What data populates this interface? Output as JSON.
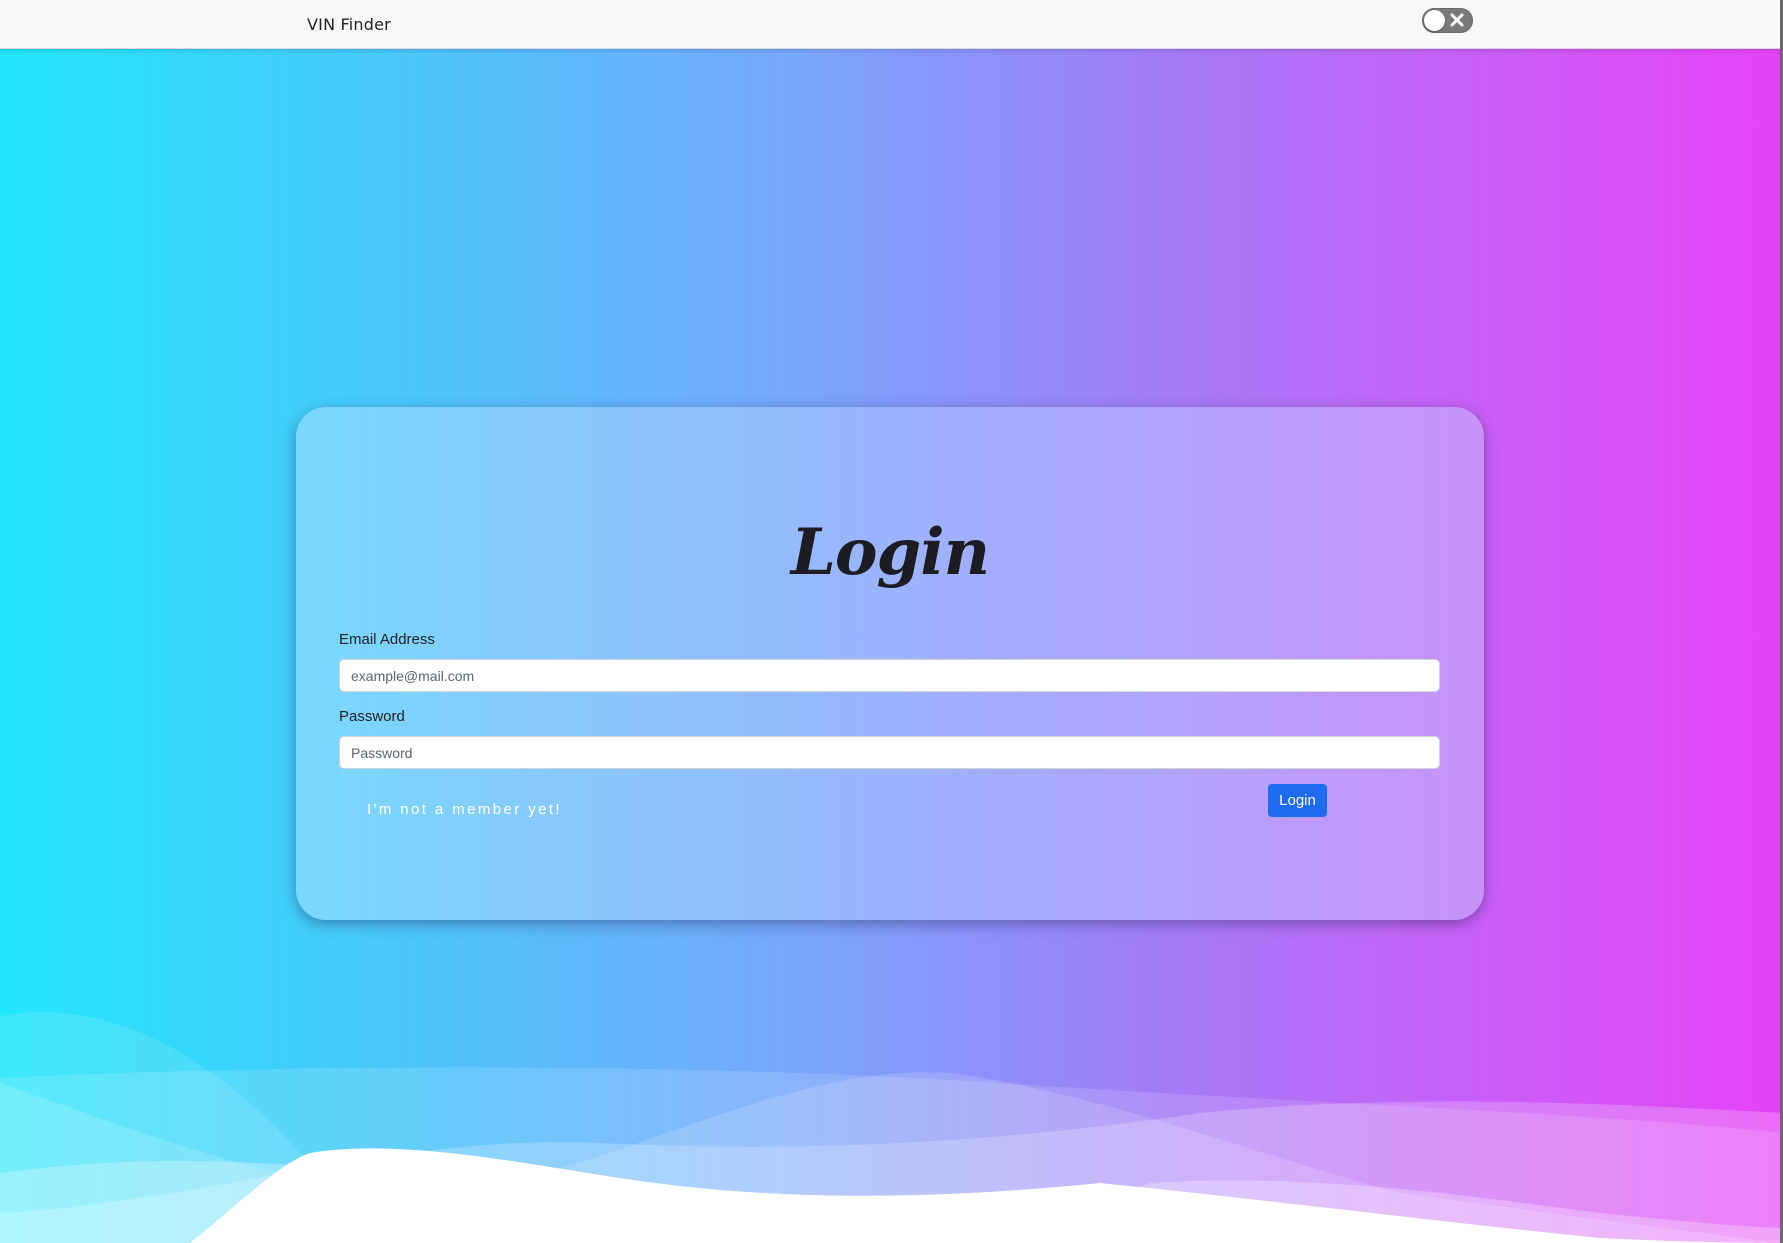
{
  "navbar": {
    "brand": "VIN Finder",
    "theme_toggle": {
      "state": "off"
    }
  },
  "login": {
    "title": "Login",
    "email": {
      "label": "Email Address",
      "placeholder": "example@mail.com",
      "value": ""
    },
    "password": {
      "label": "Password",
      "placeholder": "Password",
      "value": ""
    },
    "signup_link": "I'm not a member yet!",
    "submit_label": "Login"
  },
  "colors": {
    "gradient_start": "#22e6fb",
    "gradient_end": "#e642f7",
    "primary_button": "#1f6bf0"
  },
  "icons": [
    "close-icon"
  ]
}
